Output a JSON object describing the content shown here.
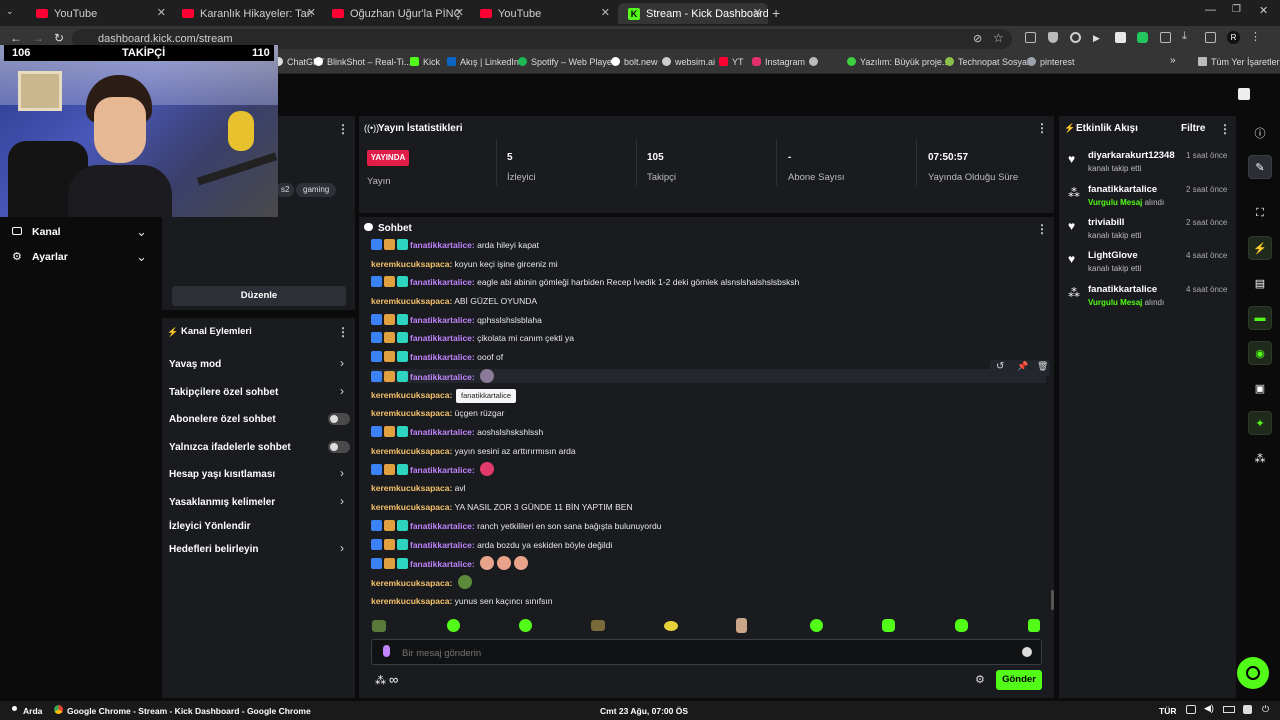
{
  "browser": {
    "tabs": [
      {
        "title": "YouTube",
        "icon": "youtube-icon"
      },
      {
        "title": "Karanlık Hikayeler: Tarsus Kazası",
        "icon": "youtube-icon"
      },
      {
        "title": "Oğuzhan Uğur'la PİNÇ: Bölüm",
        "icon": "youtube-icon"
      },
      {
        "title": "YouTube",
        "icon": "youtube-icon"
      },
      {
        "title": "Stream - Kick Dashboard",
        "icon": "kick-icon"
      }
    ],
    "url": "dashboard.kick.com/stream",
    "bookmarks": [
      "ChatGPT",
      "BlinkShot – Real-Ti...",
      "Kick",
      "Akış | LinkedIn",
      "Spotify – Web Player",
      "bolt.new",
      "websim.ai",
      "YT",
      "Instagram",
      "Yazılım: Büyük proje...",
      "Technopat Sosyal",
      "pinterest"
    ],
    "bookmarks_all": "Tüm Yer İşaretleri"
  },
  "overlay": {
    "left_count": "106",
    "label": "TAKİPÇİ",
    "right_count": "110"
  },
  "left": {
    "tags": [
      "s2",
      "gaming"
    ],
    "nav": [
      {
        "label": "Kanal"
      },
      {
        "label": "Ayarlar"
      }
    ],
    "edit_button": "Düzenle",
    "actions_title": "Kanal Eylemleri",
    "actions": [
      {
        "label": "Yavaş mod",
        "control": "chevron"
      },
      {
        "label": "Takipçilere özel sohbet",
        "control": "chevron"
      },
      {
        "label": "Abonelere özel sohbet",
        "control": "toggle"
      },
      {
        "label": "Yalnızca ifadelerle sohbet",
        "control": "toggle"
      },
      {
        "label": "Hesap yaşı kısıtlaması",
        "control": "chevron"
      },
      {
        "label": "Yasaklanmış kelimeler",
        "control": "chevron"
      },
      {
        "label": "İzleyici Yönlendir",
        "control": "none"
      },
      {
        "label": "Hedefleri belirleyin",
        "control": "chevron"
      }
    ]
  },
  "stats": {
    "title": "Yayın İstatistikleri",
    "live_badge": "YAYINDA",
    "items": [
      {
        "value": "",
        "label": "Yayın"
      },
      {
        "value": "5",
        "label": "İzleyici"
      },
      {
        "value": "105",
        "label": "Takipçi"
      },
      {
        "value": "-",
        "label": "Abone Sayısı"
      },
      {
        "value": "07:50:57",
        "label": "Yayında Olduğu Süre"
      }
    ]
  },
  "chat": {
    "title": "Sohbet",
    "tooltip": "fanatikkartalice",
    "messages": [
      {
        "user": "fanatikkartalice",
        "badges": true,
        "text": "arda hileyi kapat"
      },
      {
        "user": "keremkucuksapaca",
        "badges": false,
        "text": "koyun keçi işine girceniz mi"
      },
      {
        "user": "fanatikkartalice",
        "badges": true,
        "text": "eagle abi abinin gömleği harbiden Recep İvedik 1-2 deki gömlek alsnslshalshslsbsksh"
      },
      {
        "user": "keremkucuksapaca",
        "badges": false,
        "text": "ABİ GÜZEL OYUNDA"
      },
      {
        "user": "fanatikkartalice",
        "badges": true,
        "text": "qphsslshslsblaha"
      },
      {
        "user": "fanatikkartalice",
        "badges": true,
        "text": "çikolata mi canım çekti ya"
      },
      {
        "user": "fanatikkartalice",
        "badges": true,
        "text": "ooof of"
      },
      {
        "user": "fanatikkartalice",
        "badges": true,
        "text": "",
        "emote": "#8a7a9a"
      },
      {
        "user": "keremkucuksapaca",
        "badges": false,
        "text": ""
      },
      {
        "user": "keremkucuksapaca",
        "badges": false,
        "text": "üçgen rüzgar"
      },
      {
        "user": "fanatikkartalice",
        "badges": true,
        "text": "aoshslshskshlssh"
      },
      {
        "user": "keremkucuksapaca",
        "badges": false,
        "text": "yayın sesini az arttırırmısın arda"
      },
      {
        "user": "fanatikkartalice",
        "badges": true,
        "text": "",
        "emote": "#e23a6a"
      },
      {
        "user": "keremkucuksapaca",
        "badges": false,
        "text": "avl"
      },
      {
        "user": "keremkucuksapaca",
        "badges": false,
        "text": "YA NASIL ZOR 3 GÜNDE 11 BİN YAPTIM BEN"
      },
      {
        "user": "fanatikkartalice",
        "badges": true,
        "text": "ranch yetkilileri en son sana bağışta bulunuyordu"
      },
      {
        "user": "fanatikkartalice",
        "badges": true,
        "text": "arda bozdu ya eskiden böyle değildi"
      },
      {
        "user": "fanatikkartalice",
        "badges": true,
        "text": "",
        "emote": "#e7a48a",
        "emote_count": 3
      },
      {
        "user": "keremkucuksapaca",
        "badges": false,
        "text": "",
        "emote": "#5a8a3a"
      },
      {
        "user": "keremkucuksapaca",
        "badges": false,
        "text": "yunus sen kaçıncı sınıfsın"
      }
    ],
    "input_placeholder": "Bir mesaj gönderin",
    "send_button": "Gönder"
  },
  "activity": {
    "title": "Etkinlik Akışı",
    "filter": "Filtre",
    "items": [
      {
        "icon": "heart-icon",
        "name": "diyarkarakurt12348",
        "sub": "kanalı takip etti",
        "time": "1 saat önce",
        "highlight": false
      },
      {
        "icon": "kick-drops-icon",
        "name": "fanatikkartalice",
        "sub": "Vurgulu Mesaj",
        "sub2": "alındı",
        "time": "2 saat önce",
        "highlight": true
      },
      {
        "icon": "heart-icon",
        "name": "triviabill",
        "sub": "kanalı takip etti",
        "time": "2 saat önce",
        "highlight": false
      },
      {
        "icon": "heart-icon",
        "name": "LightGlove",
        "sub": "kanalı takip etti",
        "time": "4 saat önce",
        "highlight": false
      },
      {
        "icon": "kick-drops-icon",
        "name": "fanatikkartalice",
        "sub": "Vurgulu Mesaj",
        "sub2": "alındı",
        "time": "4 saat önce",
        "highlight": true
      }
    ]
  },
  "taskbar": {
    "user": "Arda",
    "window": "Google Chrome - Stream - Kick Dashboard - Google Chrome",
    "datetime": "Cmt 23 Ağu, 07:00 ÖS",
    "lang": "TÜR"
  },
  "colors": {
    "kick_green": "#53fc18",
    "live_red": "#e11d48",
    "panel": "#191b1f",
    "background": "#0b0b0c"
  }
}
